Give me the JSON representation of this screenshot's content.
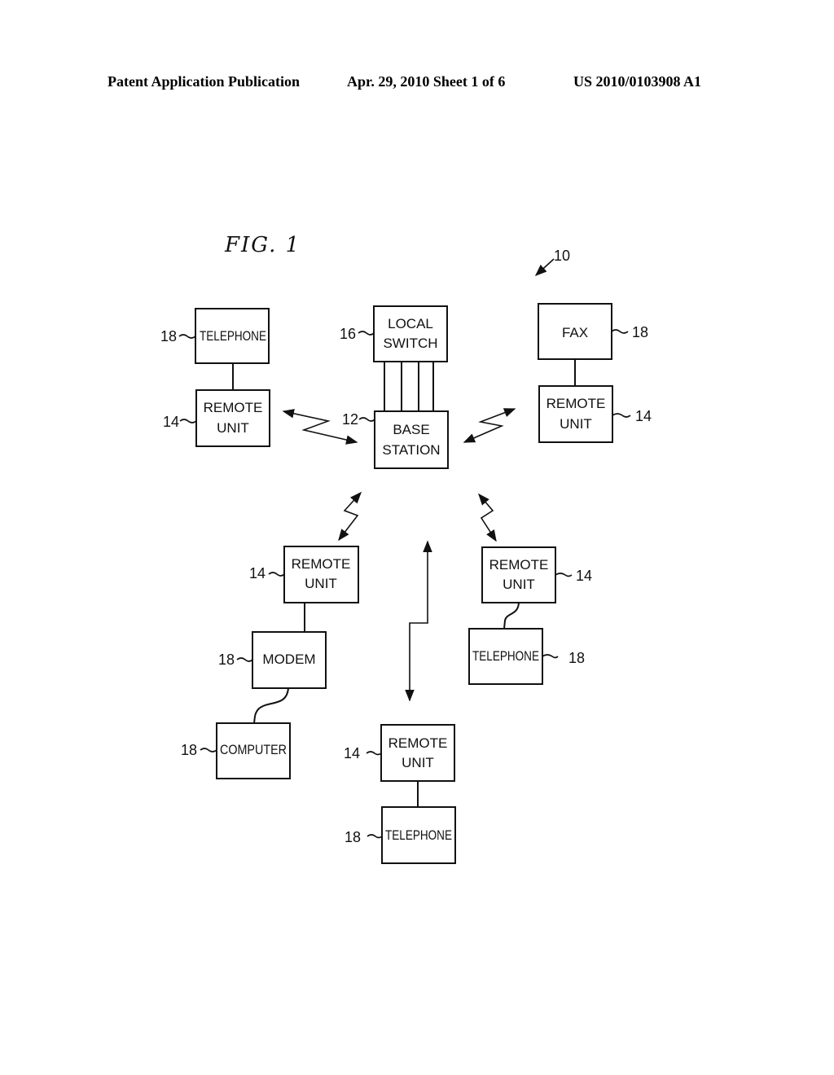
{
  "header": {
    "publication": "Patent Application Publication",
    "date_sheet": "Apr. 29, 2010  Sheet 1 of 6",
    "number": "US 2010/0103908 A1"
  },
  "figure": {
    "title": "FIG.  1",
    "system_ref": "10",
    "blocks": [
      {
        "id": "telephone-top-left",
        "lines": [
          "TELEPHONE"
        ],
        "ref": "18"
      },
      {
        "id": "remote-unit-top-left",
        "lines": [
          "REMOTE",
          "UNIT"
        ],
        "ref": "14"
      },
      {
        "id": "local-switch",
        "lines": [
          "LOCAL",
          "SWITCH"
        ],
        "ref": "16"
      },
      {
        "id": "base-station",
        "lines": [
          "BASE",
          "STATION"
        ],
        "ref": "12"
      },
      {
        "id": "fax",
        "lines": [
          "FAX"
        ],
        "ref": "18"
      },
      {
        "id": "remote-unit-top-right",
        "lines": [
          "REMOTE",
          "UNIT"
        ],
        "ref": "14"
      },
      {
        "id": "remote-unit-mid-left",
        "lines": [
          "REMOTE",
          "UNIT"
        ],
        "ref": "14"
      },
      {
        "id": "modem",
        "lines": [
          "MODEM"
        ],
        "ref": "18"
      },
      {
        "id": "computer",
        "lines": [
          "COMPUTER"
        ],
        "ref": "18"
      },
      {
        "id": "remote-unit-mid-right",
        "lines": [
          "REMOTE",
          "UNIT"
        ],
        "ref": "14"
      },
      {
        "id": "telephone-mid-right",
        "lines": [
          "TELEPHONE"
        ],
        "ref": "18"
      },
      {
        "id": "remote-unit-bottom",
        "lines": [
          "REMOTE",
          "UNIT"
        ],
        "ref": "14"
      },
      {
        "id": "telephone-bottom",
        "lines": [
          "TELEPHONE"
        ],
        "ref": "18"
      }
    ]
  }
}
